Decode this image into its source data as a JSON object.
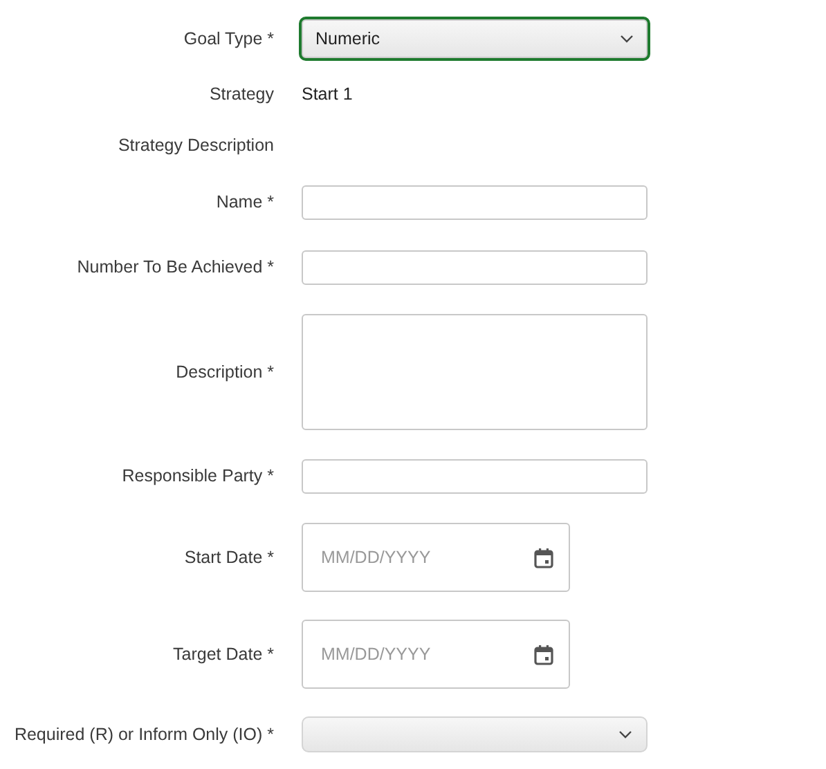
{
  "fields": [
    {
      "kind": "select",
      "label": "Goal Type *",
      "value": "Numeric",
      "focused": true
    },
    {
      "kind": "static",
      "label": "Strategy",
      "value": "Start 1"
    },
    {
      "kind": "static",
      "label": "Strategy Description"
    },
    {
      "kind": "text",
      "label": "Name *"
    },
    {
      "kind": "text",
      "label": "Number To Be Achieved *"
    },
    {
      "kind": "textarea",
      "label": "Description *"
    },
    {
      "kind": "text",
      "label": "Responsible Party *"
    },
    {
      "kind": "date",
      "label": "Start Date *",
      "placeholder": "MM/DD/YYYY"
    },
    {
      "kind": "date",
      "label": "Target Date *",
      "placeholder": "MM/DD/YYYY"
    },
    {
      "kind": "select",
      "label": "Required (R) or Inform Only (IO) *",
      "focused": false
    }
  ]
}
